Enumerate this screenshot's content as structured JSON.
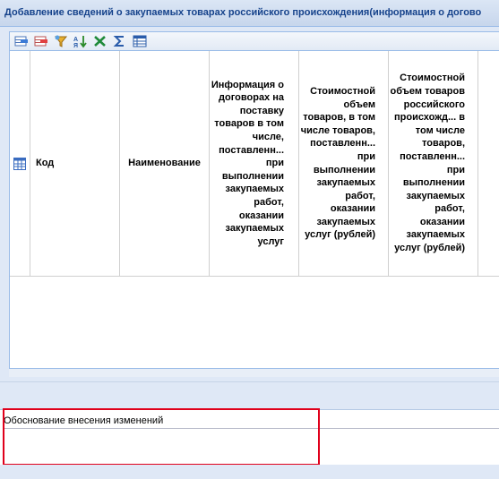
{
  "window": {
    "title": "Добавление сведений о закупаемых товарах российского происхождения(информация о догово"
  },
  "toolbar": {
    "buttons": [
      {
        "icon": "add-row-icon"
      },
      {
        "icon": "delete-row-icon"
      },
      {
        "icon": "filter-icon"
      },
      {
        "icon": "sort-icon"
      },
      {
        "icon": "excel-icon"
      },
      {
        "icon": "sum-icon"
      },
      {
        "icon": "columns-icon"
      }
    ]
  },
  "grid": {
    "columns": [
      {
        "label": ""
      },
      {
        "label": "Код"
      },
      {
        "label": "Наименование"
      },
      {
        "label": "Информация о договорах на поставку товаров в том числе, поставленн... при выполнении закупаемых работ, оказании закупаемых услуг"
      },
      {
        "label": "Стоимостной объем товаров, в том числе товаров, поставленн... при выполнении закупаемых работ, оказании закупаемых услуг (рублей)"
      },
      {
        "label": "Стоимостной объем товаров российского происхожд... в том числе товаров, поставленн... при выполнении закупаемых работ, оказании закупаемых услуг (рублей)"
      }
    ],
    "rows": []
  },
  "justification": {
    "label": "Обоснование внесения изменений",
    "value": ""
  },
  "colors": {
    "title_text": "#15428b",
    "border": "#99bbe8",
    "highlight": "#e0001b"
  }
}
